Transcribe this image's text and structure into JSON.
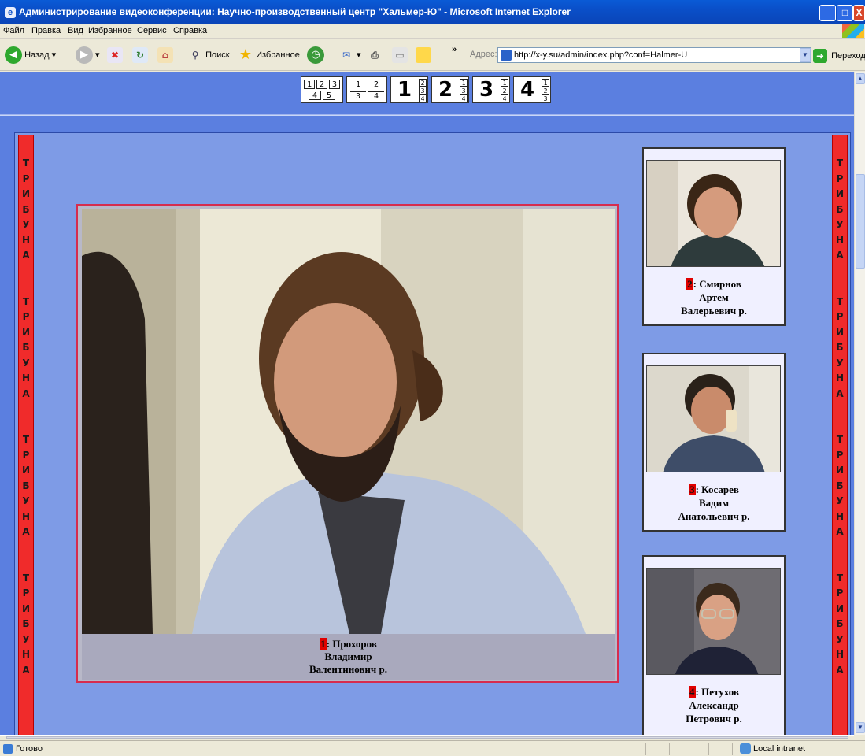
{
  "window": {
    "title": "Администрирование видеоконференции: Научно-производственный центр \"Хальмер-Ю\" - Microsoft Internet Explorer",
    "min": "_",
    "max": "□",
    "close": "X"
  },
  "menu": [
    "Файл",
    "Правка",
    "Вид",
    "Избранное",
    "Сервис",
    "Справка"
  ],
  "toolbar": {
    "back": "Назад",
    "search": "Поиск",
    "favorites": "Избранное",
    "more": "»",
    "address_label": "Адрес:",
    "address_value": "http://x-y.su/admin/index.php?conf=Halmer-U",
    "go": "Переход"
  },
  "layouts": {
    "grid5": [
      "1",
      "2",
      "3",
      "4",
      "5"
    ],
    "grid4": [
      "1",
      "2",
      "3",
      "4"
    ],
    "focus": [
      {
        "big": "1",
        "small": [
          "2",
          "3",
          "4"
        ]
      },
      {
        "big": "2",
        "small": [
          "1",
          "3",
          "4"
        ]
      },
      {
        "big": "3",
        "small": [
          "1",
          "2",
          "4"
        ]
      },
      {
        "big": "4",
        "small": [
          "1",
          "2",
          "3"
        ]
      }
    ]
  },
  "tribuna": {
    "word": "ТРИБУНА"
  },
  "main_speaker": {
    "number": "1",
    "name_line1": ": Прохоров",
    "name_line2": "Владимир",
    "name_line3": "Валентинович р."
  },
  "participants": [
    {
      "number": "2",
      "line1": ": Смирнов",
      "line2": "Артем",
      "line3": "Валерьевич р."
    },
    {
      "number": "3",
      "line1": ": Косарев",
      "line2": "Вадим",
      "line3": "Анатольевич р."
    },
    {
      "number": "4",
      "line1": ": Петухов",
      "line2": "Александр",
      "line3": "Петрович р."
    }
  ],
  "status": {
    "text": "Готово",
    "zone": "Local intranet"
  },
  "colors": {
    "page_bg": "#5b7fe0",
    "tribuna": "#f02b2b",
    "badge": "#e00000",
    "main_border": "#d62c4e"
  }
}
